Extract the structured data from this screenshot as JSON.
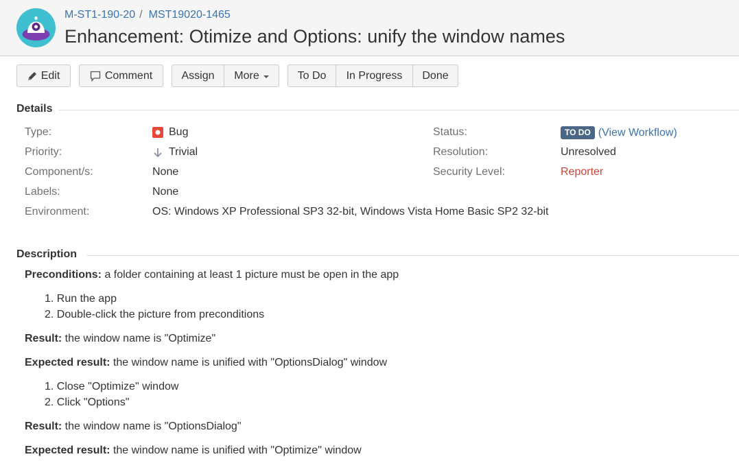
{
  "header": {
    "project_crumb": "M-ST1-190-20",
    "crumb_separator": "/",
    "issue_key": "MST19020-1465",
    "title": "Enhancement: Otimize and Options: unify the window names"
  },
  "toolbar": {
    "edit": "Edit",
    "comment": "Comment",
    "assign": "Assign",
    "more": "More",
    "todo": "To Do",
    "in_progress": "In Progress",
    "done": "Done"
  },
  "details": {
    "heading": "Details",
    "type_label": "Type:",
    "type_value": "Bug",
    "priority_label": "Priority:",
    "priority_value": "Trivial",
    "components_label": "Component/s:",
    "components_value": "None",
    "labels_label": "Labels:",
    "labels_value": "None",
    "environment_label": "Environment:",
    "environment_value": "OS: Windows XP Professional SP3 32-bit, Windows Vista Home Basic SP2 32-bit",
    "status_label": "Status:",
    "status_value": "TO DO",
    "status_open_paren": "(",
    "status_link": "View Workflow",
    "status_close_paren": ")",
    "resolution_label": "Resolution:",
    "resolution_value": "Unresolved",
    "security_label": "Security Level:",
    "security_value": "Reporter"
  },
  "description": {
    "heading": "Description",
    "preconditions_label": "Preconditions:",
    "preconditions_text": " a folder containing at least 1 picture must be open in the app",
    "steps1": [
      "1. Run the app",
      "2. Double-click the picture from preconditions"
    ],
    "result1_label": "Result:",
    "result1_text": " the window name is \"Optimize\"",
    "expected1_label": "Expected result:",
    "expected1_text": " the window name is unified with \"OptionsDialog\" window",
    "steps2": [
      "1. Close \"Optimize\" window",
      "2. Click \"Options\""
    ],
    "result2_label": "Result:",
    "result2_text": " the window name is \"OptionsDialog\"",
    "expected2_label": "Expected result:",
    "expected2_text": " the window name is unified with \"Optimize\" window"
  },
  "colors": {
    "link": "#3b73af",
    "status_lozenge": "#4a6785",
    "bug_red": "#d04437",
    "header_bg": "#f5f5f5"
  },
  "icons": {
    "avatar": "project-avatar-icon",
    "edit": "pencil-icon",
    "comment": "speech-bubble-icon",
    "more": "chevron-down-icon",
    "bug": "bug-icon",
    "priority": "arrow-down-icon"
  }
}
